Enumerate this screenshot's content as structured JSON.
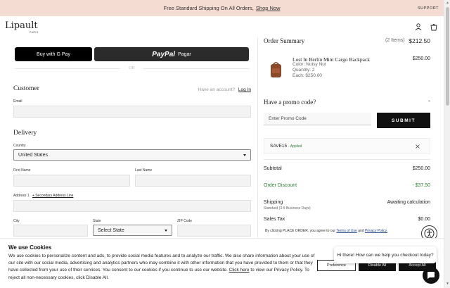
{
  "announcement": {
    "text": "Free Standard Shipping On All Orders,",
    "link": "Shop Now",
    "support": "SUPPORT"
  },
  "header": {
    "logo": "Lipault",
    "logo_sub": "PARIS"
  },
  "express": {
    "gpay_label": "Buy with",
    "gpay_brand": "G Pay",
    "paypal_brand": "PayPal",
    "paypal_label": "Pagar",
    "or": "OR"
  },
  "customer": {
    "title": "Customer",
    "have_account": "Have an account?",
    "login": "Log In",
    "email_label": "Email"
  },
  "delivery": {
    "title": "Delivery",
    "country_label": "Country",
    "country_value": "United States",
    "first_name_label": "First Name",
    "last_name_label": "Last Name",
    "address1_label": "Address 1",
    "address2_link": "+ Secondary Address Line",
    "city_label": "City",
    "state_label": "State",
    "state_value": "Select State",
    "zip_label": "ZIP Code"
  },
  "summary": {
    "title": "Order Summary",
    "items": "(2 Items)",
    "total": "$212.50",
    "product": {
      "name": "Lost In Berlin Mini Cargo Backpack",
      "color": "Color: Nutsy Nut",
      "quantity": "Quantity: 2",
      "each": "Each: $250.00",
      "price": "$250.00"
    },
    "promo_title": "Have a promo code?",
    "promo_toggle": "-",
    "promo_placeholder": "Enter Promo Code",
    "submit": "SUBMIT",
    "applied_code": "SAVE15",
    "applied_label": "- Applied",
    "subtotal_label": "Subtotal",
    "subtotal_value": "$250.00",
    "discount_label": "Order Discount",
    "discount_value": "- $37.50",
    "shipping_label": "Shipping",
    "shipping_sub": "Standard (3-5 Business Days)",
    "shipping_value": "Awaiting calculation",
    "tax_label": "Sales Tax",
    "tax_value": "$0.00",
    "terms_pre": "By clicking PLACE ORDER, you agree to our",
    "terms_link": "Terms of Use",
    "and": "and",
    "privacy_link": "Privacy Policy."
  },
  "cookie": {
    "title": "We use Cookies",
    "text_1": "We use cookies to personalize content and ads, to provide social media features and to analyze our traffic. We also share information about your use of our site with our social media, advertising and analytics partners who may combine it with other information that you have provided to them or that they have collected from your use of their services. You consent to our cookies if you continue to use our website.",
    "click_here": "Click here",
    "text_2": "to view our Privacy Policy. To reject all non-necessary cookies, click Disable All.",
    "preference": "Preference",
    "disable_all": "Disable All",
    "accept_all": "Accept All"
  },
  "chat": {
    "greeting": "Hi there! How can we help you checkout today?"
  },
  "colors": {
    "announcement_bg": "#f4dcd2",
    "discount_green": "#2e7d32",
    "applied_green": "#2e7d32",
    "dark": "#111111"
  }
}
